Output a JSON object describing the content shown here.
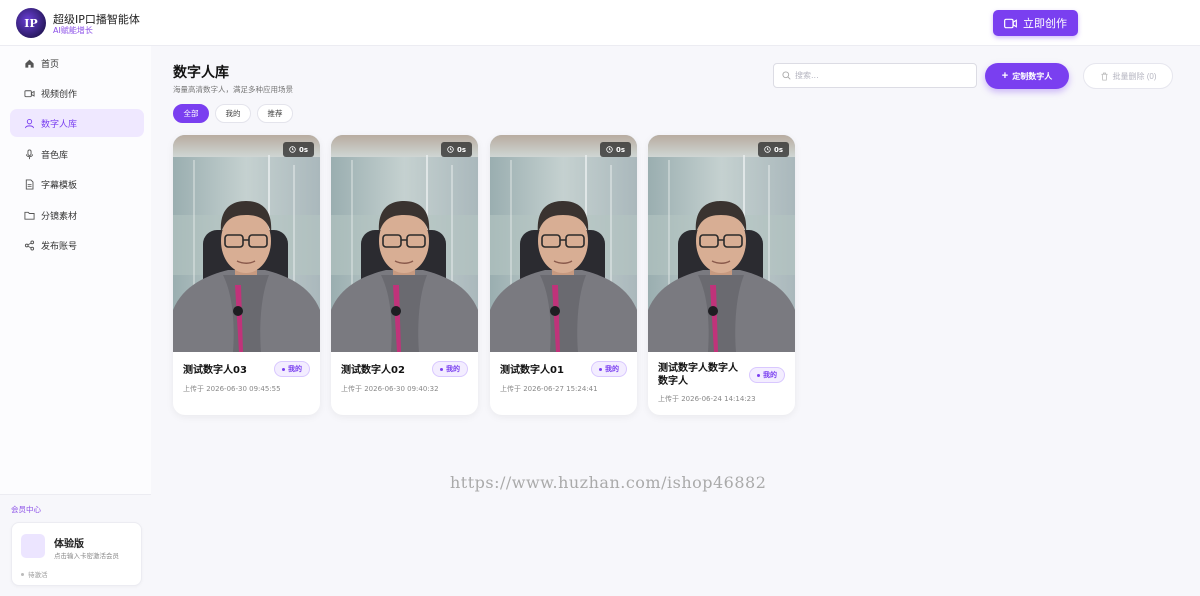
{
  "header": {
    "logo_text": "IP",
    "app_title": "超级IP口播智能体",
    "app_subtitle": "AI赋能增长",
    "create_label": "立即创作"
  },
  "sidebar": {
    "items": [
      {
        "label": "首页",
        "icon": "home-icon",
        "active": false
      },
      {
        "label": "视频创作",
        "icon": "video-icon",
        "active": false
      },
      {
        "label": "数字人库",
        "icon": "user-icon",
        "active": true
      },
      {
        "label": "音色库",
        "icon": "microphone-icon",
        "active": false
      },
      {
        "label": "字幕模板",
        "icon": "document-icon",
        "active": false
      },
      {
        "label": "分镜素材",
        "icon": "folder-icon",
        "active": false
      },
      {
        "label": "发布账号",
        "icon": "share-icon",
        "active": false
      }
    ],
    "member": {
      "title": "会员中心",
      "plan": "体验版",
      "desc": "点击输入卡密激活会员",
      "status": "待激活"
    }
  },
  "main": {
    "title": "数字人库",
    "subtitle": "海量高清数字人，满足多种应用场景",
    "filters": [
      {
        "label": "全部",
        "active": true
      },
      {
        "label": "我的",
        "active": false
      },
      {
        "label": "推荐",
        "active": false
      }
    ],
    "search": {
      "placeholder": "搜索..."
    },
    "custom_label": "定制数字人",
    "batch_delete_label": "批量删除 (0)",
    "cards": [
      {
        "name": "测试数字人03",
        "tag": "我的",
        "duration": "0s",
        "time": "上传于 2026-06-30 09:45:55"
      },
      {
        "name": "测试数字人02",
        "tag": "我的",
        "duration": "0s",
        "time": "上传于 2026-06-30 09:40:32"
      },
      {
        "name": "测试数字人01",
        "tag": "我的",
        "duration": "0s",
        "time": "上传于 2026-06-27 15:24:41"
      },
      {
        "name": "测试数字人数字人数字人",
        "tag": "我的",
        "duration": "0s",
        "time": "上传于 2026-06-24 14:14:23"
      }
    ]
  },
  "watermark": "https://www.huzhan.com/ishop46882",
  "colors": {
    "accent": "#7a3ff0",
    "accent_light": "#efe8ff",
    "background": "#f7f7fb"
  }
}
